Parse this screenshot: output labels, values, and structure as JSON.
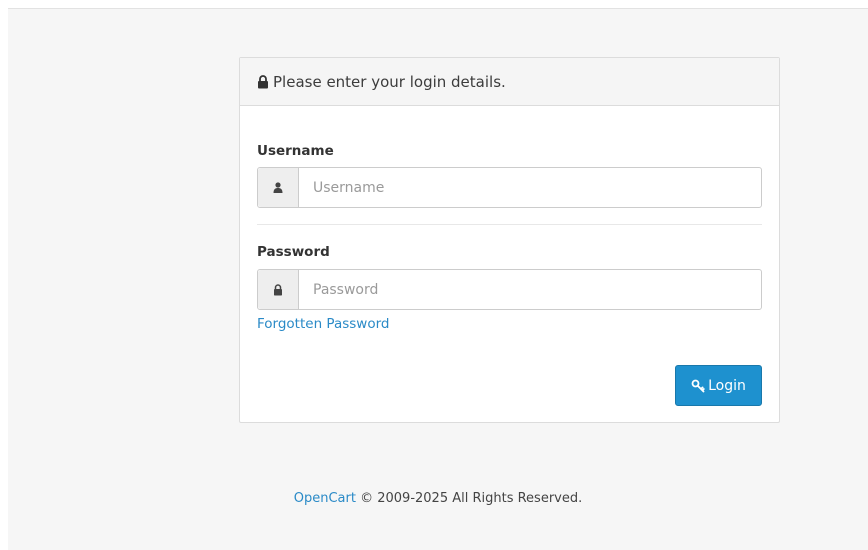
{
  "panel": {
    "heading": "Please enter your login details.",
    "heading_icon": "lock-icon"
  },
  "username": {
    "label": "Username",
    "placeholder": "Username",
    "value": "",
    "icon": "user-icon"
  },
  "password": {
    "label": "Password",
    "placeholder": "Password",
    "value": "",
    "icon": "lock-icon"
  },
  "forgot_link": "Forgotten Password",
  "login_button": {
    "label": "Login",
    "icon": "key-icon"
  },
  "footer": {
    "brand_link": "OpenCart",
    "text": " © 2009-2025 All Rights Reserved."
  },
  "colors": {
    "primary": "#1e91cf",
    "link": "#2a8ac7",
    "page_background": "#f6f6f6"
  }
}
